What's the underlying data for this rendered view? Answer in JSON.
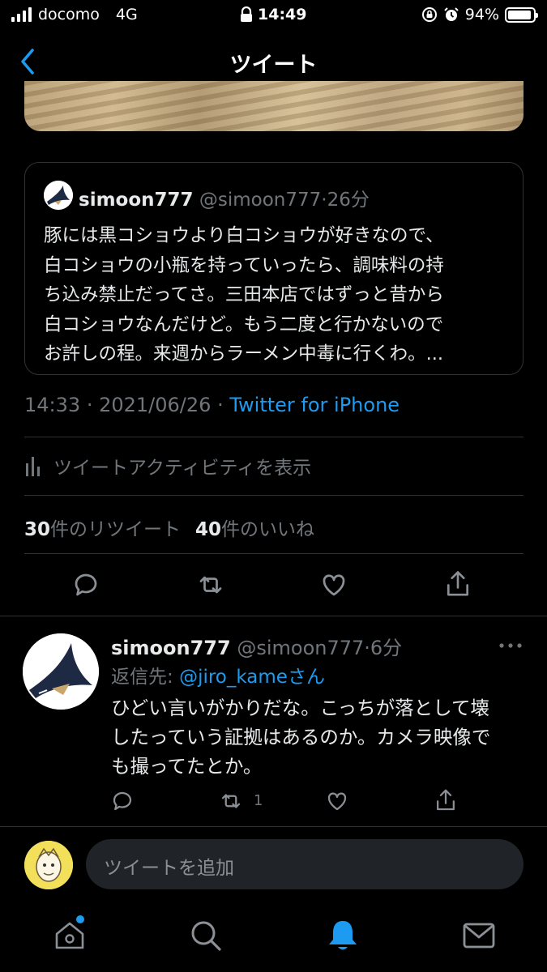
{
  "status_bar": {
    "carrier": "docomo",
    "network": "4G",
    "time": "14:49",
    "battery": "94%",
    "battery_level": 0.94
  },
  "header": {
    "title": "ツイート"
  },
  "quoted_tweet": {
    "display_name": "simoon777",
    "handle": "@simoon777",
    "time_sep": "·",
    "age": "26分",
    "lines": [
      "豚には黒コショウより白コショウが好きなので、",
      "白コショウの小瓶を持っていったら、調味料の持",
      "ち込み禁止だってさ。三田本店ではずっと昔から",
      "白コショウなんだけど。もう二度と行かないので",
      "お許しの程。来週からラーメン中毒に行くわ。..."
    ]
  },
  "tweet_meta": {
    "time": "14:33",
    "sep1": "·",
    "date": "2021/06/26",
    "sep2": "·",
    "source": "Twitter for iPhone"
  },
  "activity": {
    "label": "ツイートアクティビティを表示"
  },
  "counts": {
    "retweets": "30",
    "retweets_label": "件のリツイート",
    "likes": "40",
    "likes_label": "件のいいね"
  },
  "reply": {
    "display_name": "simoon777",
    "handle": "@simoon777",
    "time_sep": "·",
    "age": "6分",
    "reply_to_prefix": "返信先: ",
    "reply_to_handle": "@jiro_kame",
    "reply_to_suffix": "さん",
    "lines": [
      "ひどい言いがかりだな。こっちが落として壊",
      "したっていう証拠はあるのか。カメラ映像で",
      "も撮ってたとか。"
    ],
    "retweet_count": "1"
  },
  "compose": {
    "placeholder": "ツイートを追加"
  },
  "colors": {
    "accent": "#1d9bf0",
    "background": "#000000",
    "muted": "#71767b",
    "divider": "#2f3336"
  },
  "tab_bar": {
    "items": [
      "home-icon",
      "search-icon",
      "notifications-icon",
      "messages-icon"
    ],
    "active": "notifications-icon"
  }
}
